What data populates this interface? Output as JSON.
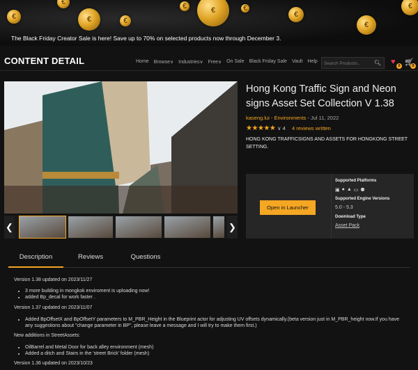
{
  "banner": {
    "text": "The Black Friday Creator Sale is here! Save up to 70% on selected products now through December 3."
  },
  "header": {
    "logo": "CONTENT DETAIL",
    "nav": [
      "Home",
      "Browse",
      "Industries",
      "Free",
      "On Sale",
      "Black Friday Sale",
      "Vault",
      "Help"
    ],
    "search_placeholder": "Search Products..",
    "wishlist_count": "0",
    "cart_count": "0"
  },
  "product": {
    "title": "Hong Kong Traffic Sign and Neon signs Asset Set Collection V 1.38",
    "seller": "kaseng.lui",
    "category": "Environments",
    "date": "Jul 11, 2022",
    "meta_sep1": " - ",
    "meta_sep2": " - ",
    "rating": 5,
    "rating_count": "4",
    "reviews_link": "4 reviews written",
    "short_description": "HONG KONG TRAFFICSIGNS AND ASSETS FOR HONGKONG STREET SETTING."
  },
  "purchase_panel": {
    "button_label": "Open in Launcher",
    "platforms_label": "Supported Platforms",
    "engine_label": "Supported Engine Versions",
    "engine_value": "5.0 - 5.3",
    "download_label": "Download Type",
    "download_value": "Asset Pack"
  },
  "tabs": [
    "Description",
    "Reviews",
    "Questions"
  ],
  "active_tab": "Description",
  "description": {
    "v138_heading": "Version 1.38 updated on 2023/11/27",
    "v138_items": [
      "3 more building in mongkok enviroment is uploading now!",
      "added Bp_decal for work faster ."
    ],
    "v137_heading": "Version 1.37 updated on 2023/11/07",
    "v137_items": [
      "Added BpOffsetX and BpOffsetY parameters to M_PBR_Height in the Blueprint actor for adjusting UV offsets dynamically.(beta version just in M_PBR_height now.If you have any suggestions about \"change parameter in BP\", please leave a message and I will try to make them first.)"
    ],
    "street_heading": "New additions in StreetAssets:",
    "street_items": [
      "OilBarrel and Metal Door for back alley environment (mesh)",
      "Added a ditch and Stairs in the 'street Brick' folder (mesh)"
    ],
    "v136_heading": "Version 1.36 updated on 2023/10/23"
  }
}
